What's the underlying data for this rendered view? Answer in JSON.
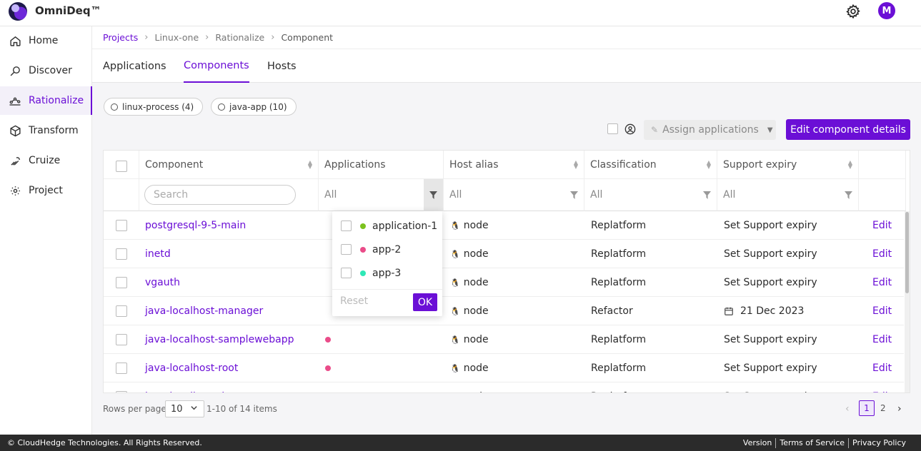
{
  "brand": {
    "name": "OmniDeq™"
  },
  "topbar": {
    "settings_icon": "gear-icon",
    "avatar_initial": "M"
  },
  "sidebar": {
    "items": [
      {
        "label": "Home",
        "icon": "home-icon"
      },
      {
        "label": "Discover",
        "icon": "discover-icon"
      },
      {
        "label": "Rationalize",
        "icon": "rationalize-icon",
        "active": true
      },
      {
        "label": "Transform",
        "icon": "cube-icon"
      },
      {
        "label": "Cruize",
        "icon": "cruize-icon"
      },
      {
        "label": "Project",
        "icon": "gear-icon"
      }
    ]
  },
  "breadcrumb": {
    "projects": "Projects",
    "project": "Linux-one",
    "section": "Rationalize",
    "current": "Component",
    "separator": "›"
  },
  "tabs": [
    {
      "label": "Applications"
    },
    {
      "label": "Components",
      "active": true
    },
    {
      "label": "Hosts"
    }
  ],
  "chips": [
    {
      "label": "linux-process (4)"
    },
    {
      "label": "java-app (10)"
    }
  ],
  "toolbar": {
    "assign_label": "Assign applications",
    "edit_details_label": "Edit component details"
  },
  "table": {
    "headers": {
      "component": "Component",
      "applications": "Applications",
      "host_alias": "Host alias",
      "classification": "Classification",
      "support_expiry": "Support expiry"
    },
    "filters": {
      "search_placeholder": "Search",
      "applications": "All",
      "host_alias": "All",
      "classification": "All",
      "support_expiry": "All"
    },
    "rows": [
      {
        "component": "postgresql-9-5-main",
        "app_dot": "",
        "host": "node",
        "classification": "Replatform",
        "support": "Set Support expiry",
        "action": "Edit"
      },
      {
        "component": "inetd",
        "app_dot": "",
        "host": "node",
        "classification": "Replatform",
        "support": "Set Support expiry",
        "action": "Edit"
      },
      {
        "component": "vgauth",
        "app_dot": "",
        "host": "node",
        "classification": "Replatform",
        "support": "Set Support expiry",
        "action": "Edit"
      },
      {
        "component": "java-localhost-manager",
        "app_dot": "",
        "host": "node",
        "classification": "Refactor",
        "support": "21 Dec 2023",
        "support_has_calendar": true,
        "action": "Edit"
      },
      {
        "component": "java-localhost-samplewebapp",
        "app_dot": "#ea4c89",
        "host": "node",
        "classification": "Replatform",
        "support": "Set Support expiry",
        "action": "Edit"
      },
      {
        "component": "java-localhost-root",
        "app_dot": "#ea4c89",
        "host": "node",
        "classification": "Replatform",
        "support": "Set Support expiry",
        "action": "Edit"
      },
      {
        "component": "java-localhost-docs",
        "app_dot": "",
        "host": "node",
        "classification": "Replatform",
        "support": "Set Support expiry",
        "action": "Edit"
      }
    ]
  },
  "app_filter_popup": {
    "options": [
      {
        "label": "application-1",
        "color": "#7cc21e"
      },
      {
        "label": "app-2",
        "color": "#ea4c89"
      },
      {
        "label": "app-3",
        "color": "#2ee8b6"
      }
    ],
    "reset_label": "Reset",
    "ok_label": "OK"
  },
  "pagination": {
    "rows_per_page_label": "Rows per page:",
    "rows_per_page_value": "10",
    "items_text": "1-10 of 14 items",
    "prev": "‹",
    "next": "›",
    "pages": [
      "1",
      "2"
    ],
    "current_page": "1"
  },
  "footer": {
    "copyright": "© CloudHedge Technologies. All Rights Reserved.",
    "links": [
      "Version",
      "Terms of Service",
      "Privacy Policy"
    ]
  },
  "colors": {
    "accent": "#6b0fd6",
    "footer_bg": "#2b2b2b"
  }
}
